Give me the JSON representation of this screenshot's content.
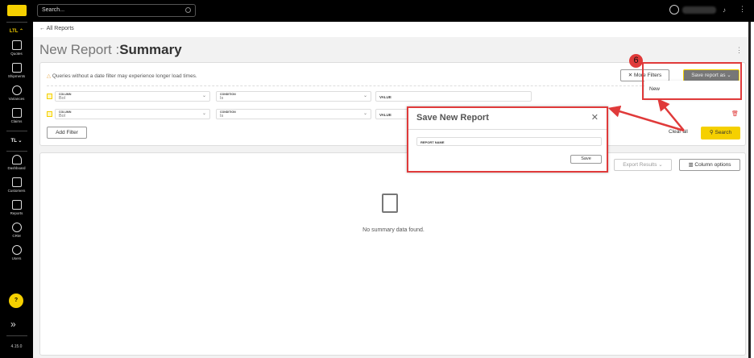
{
  "app": {
    "search_placeholder": "Search...",
    "version": "4.15.0",
    "help": "?"
  },
  "sidebar": {
    "ltl": "LTL",
    "tl": "TL",
    "items": [
      "Quotes",
      "Shipments",
      "Variances",
      "Claims",
      "Dashboard",
      "Customers",
      "Reports",
      "CRM",
      "Users"
    ]
  },
  "breadcrumb": "All Reports",
  "title": {
    "prefix": "New Report :",
    "name": "Summary"
  },
  "filters": {
    "warning": "Queries without a date filter may experience longer load times.",
    "column_label": "COLUMN",
    "condition_label": "CONDITION",
    "value_placeholder": "VALUE",
    "rows": [
      {
        "column": "Bol",
        "condition": "Is"
      },
      {
        "column": "Bol",
        "condition": "Is"
      }
    ],
    "add_filter": "Add Filter",
    "more_filters": "More Filters",
    "save_report_as": "Save report as",
    "clear_all": "Clear all",
    "search": "Search"
  },
  "save_menu": {
    "items": [
      "New"
    ]
  },
  "results": {
    "export": "Export Results",
    "column_options": "Column options",
    "empty": "No summary data found."
  },
  "modal": {
    "title": "Save New Report",
    "field_label": "REPORT NAME",
    "save": "Save"
  },
  "annotation": {
    "step": "6"
  },
  "colors": {
    "accent": "#f5d000",
    "annotation": "#e03a3a"
  }
}
